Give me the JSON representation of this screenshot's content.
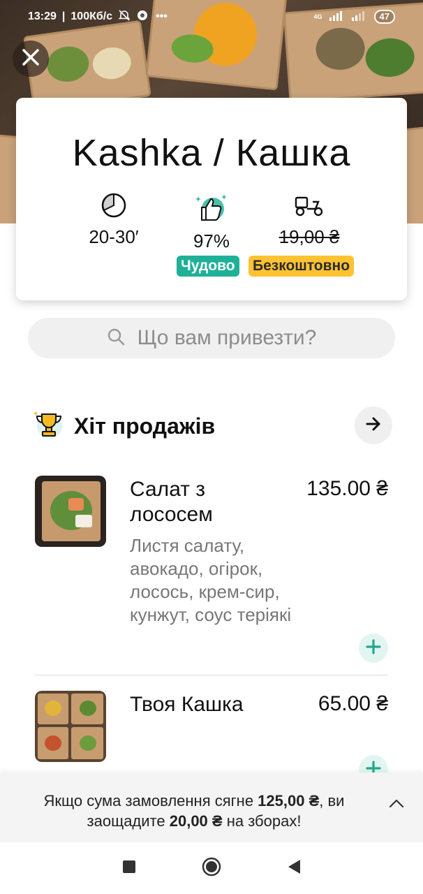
{
  "status_bar": {
    "time": "13:29",
    "network_speed": "100Кб/с",
    "network_type": "4G",
    "battery": "47"
  },
  "restaurant": {
    "name": "Kashka / Кашка",
    "delivery_time": "20-30′",
    "rating": "97%",
    "rating_badge": "Чудово",
    "delivery_fee": "19,00 ₴",
    "delivery_badge": "Безкоштовно",
    "colors": {
      "rating_badge": "#1fb09a",
      "delivery_badge": "#ffc233"
    }
  },
  "search": {
    "placeholder": "Що вам привезти?"
  },
  "section": {
    "title": "Хіт продажів"
  },
  "items": [
    {
      "name": "Салат з лососем",
      "price": "135.00 ₴",
      "description": "Листя салату, авокадо, огірок, лосось, крем-сир, кунжут, соус теріякі"
    },
    {
      "name": "Твоя Кашка",
      "price": "65.00 ₴",
      "description": ""
    }
  ],
  "banner": {
    "text_1": "Якщо сума замовлення сягне ",
    "threshold": "125,00 ₴",
    "text_2": ", ви заощадите ",
    "savings": "20,00 ₴",
    "text_3": " на зборах!"
  },
  "icons": {
    "close": "close-icon",
    "clock": "clock-icon",
    "thumbs_up": "thumbs-up-icon",
    "scooter": "scooter-icon",
    "search": "search-icon",
    "trophy": "trophy-icon",
    "arrow": "arrow-right-icon",
    "add": "plus-icon",
    "chevron": "chevron-up-icon"
  }
}
